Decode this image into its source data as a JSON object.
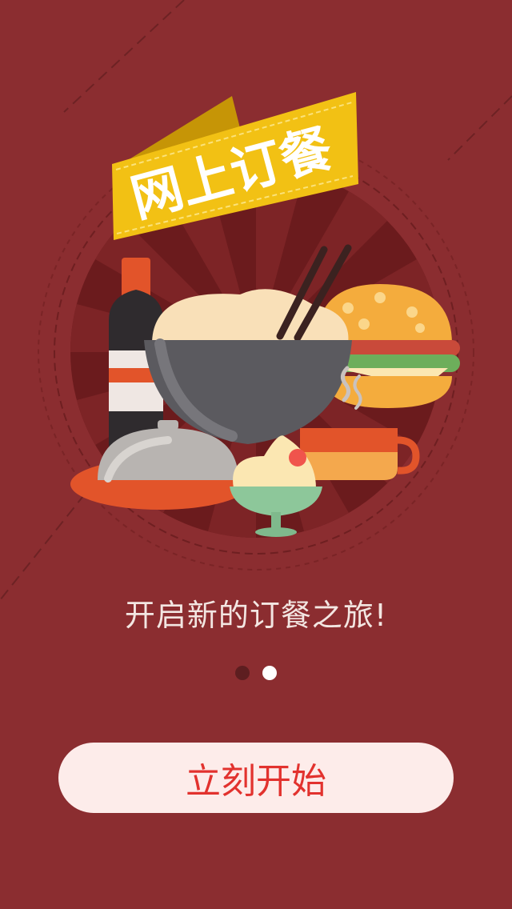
{
  "banner": {
    "title": "网上订餐"
  },
  "tagline": "开启新的订餐之旅!",
  "pagination": {
    "total": 2,
    "active_index": 1
  },
  "start_button": {
    "label": "立刻开始"
  },
  "colors": {
    "background": "#8b2d30",
    "circle": "#6b1b1d",
    "banner": "#f2c114",
    "button_bg": "#fdecea",
    "button_text": "#e2322e"
  }
}
